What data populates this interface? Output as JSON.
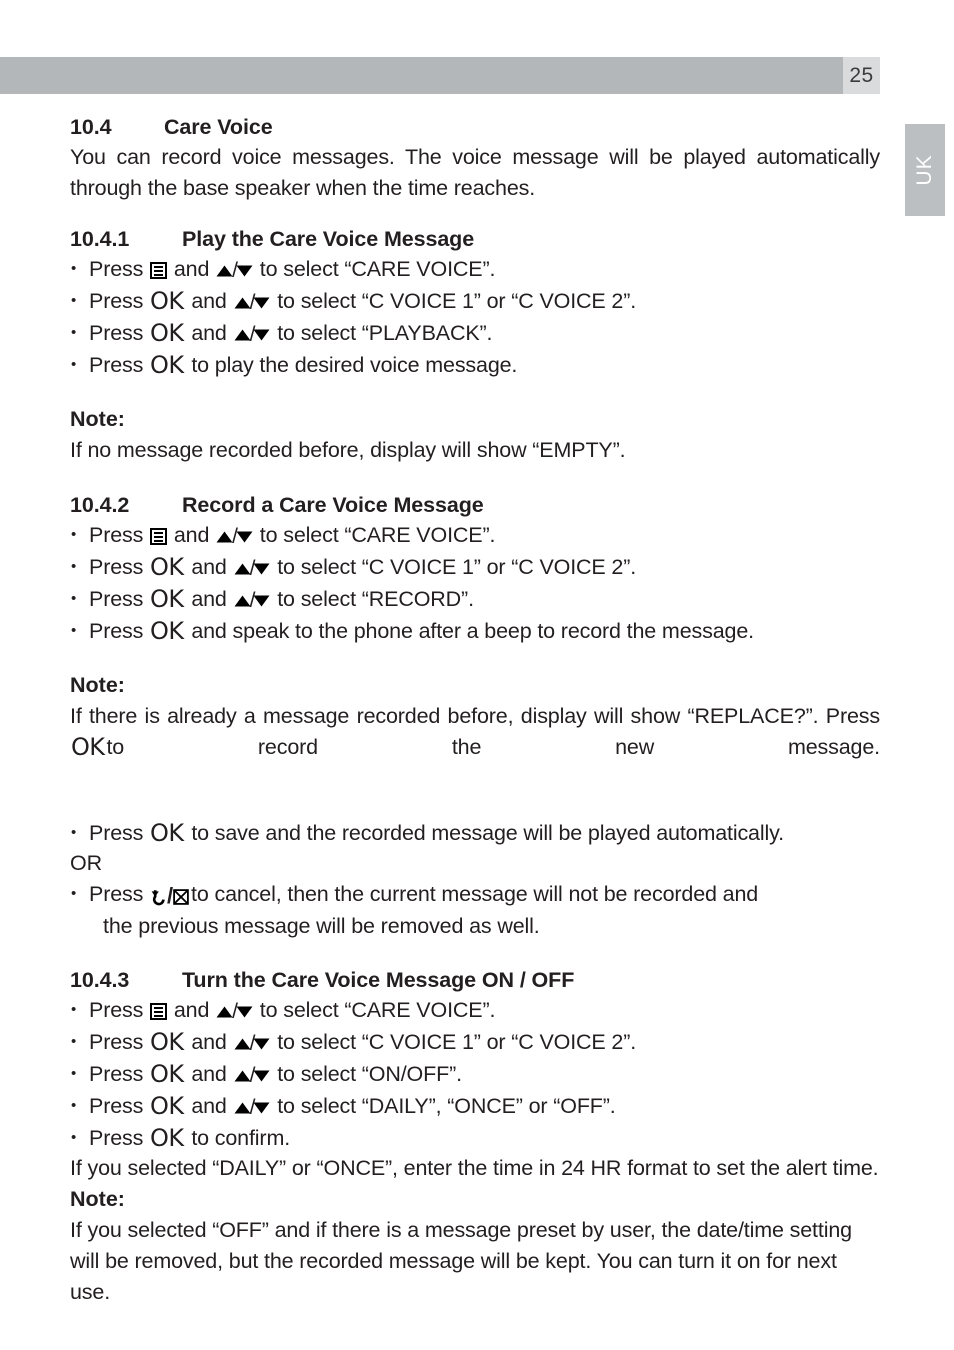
{
  "header": {
    "page_number": "25",
    "language_tab": "UK"
  },
  "sections": [
    {
      "number": "10.4",
      "title": "Care Voice",
      "intro": "You can record voice messages. The voice message will be played automatically through the base speaker when the time reaches."
    },
    {
      "number": "10.4.1",
      "title": "Play the Care Voice Message",
      "steps": [
        {
          "pre": "Press",
          "icon": "menu-icon",
          "mid": "and",
          "icon2": "up-down-arrows-icon",
          "post": "to select “CARE VOICE”."
        },
        {
          "pre": "Press",
          "icon": "ok-key-icon",
          "mid": "and",
          "icon2": "up-down-arrows-icon",
          "post": "to select “C VOICE 1” or  “C VOICE 2”."
        },
        {
          "pre": "Press",
          "icon": "ok-key-icon",
          "mid": "and",
          "icon2": "up-down-arrows-icon",
          "post": "to select  “PLAYBACK”."
        },
        {
          "pre": "Press",
          "icon": "ok-key-icon",
          "post": "to play the desired voice message."
        }
      ],
      "note_label": "Note:",
      "note_text": "If no message recorded before, display will show “EMPTY”."
    },
    {
      "number": "10.4.2",
      "title": "Record a Care Voice Message",
      "steps": [
        {
          "pre": "Press",
          "icon": "menu-icon",
          "mid": "and",
          "icon2": "up-down-arrows-icon",
          "post": "to select “CARE VOICE”."
        },
        {
          "pre": "Press",
          "icon": "ok-key-icon",
          "mid": "and",
          "icon2": "up-down-arrows-icon",
          "post": "to select “C VOICE 1” or “C VOICE 2”."
        },
        {
          "pre": "Press",
          "icon": "ok-key-icon",
          "mid": "and",
          "icon2": "up-down-arrows-icon",
          "post": "to select “RECORD”."
        },
        {
          "pre": "Press",
          "icon": "ok-key-icon",
          "post": "and speak to the phone after a beep to record the message."
        }
      ],
      "note_label": "Note:",
      "note_text_a": "If there is already a message recorded before, display will show “REPLACE?”. Press",
      "note_icon": "ok-key-icon",
      "note_text_b": "to record the new message.",
      "save_step": {
        "pre": "Press",
        "icon": "ok-key-icon",
        "post": "to save and the recorded message will be played automatically."
      },
      "or_label": "OR",
      "cancel_step": {
        "pre": "Press",
        "icon": "back-cancel-icon",
        "post": "to cancel, then the current message will not be recorded and",
        "cont": "the previous message will be removed as well."
      }
    },
    {
      "number": "10.4.3",
      "title": "Turn the Care Voice Message ON / OFF",
      "steps": [
        {
          "pre": "Press",
          "icon": "menu-icon",
          "mid": "and",
          "icon2": "up-down-arrows-icon",
          "post": "to select “CARE VOICE”."
        },
        {
          "pre": "Press",
          "icon": "ok-key-icon",
          "mid": "and",
          "icon2": "up-down-arrows-icon",
          "post": "to select “C VOICE 1” or  “C VOICE 2”."
        },
        {
          "pre": "Press",
          "icon": "ok-key-icon",
          "mid": "and",
          "icon2": "up-down-arrows-icon",
          "post": "to select “ON/OFF”."
        },
        {
          "pre": "Press",
          "icon": "ok-key-icon",
          "mid": "and",
          "icon2": "up-down-arrows-icon",
          "post": "to select  “DAILY”, “ONCE” or “OFF”."
        },
        {
          "pre": "Press",
          "icon": "ok-key-icon",
          "post": "to confirm."
        }
      ],
      "after_text": "If you selected “DAILY” or “ONCE”, enter the time in 24 HR format to set the alert time.",
      "note_label": "Note:",
      "note_text": "If you selected “OFF” and if there is a message preset by user, the date/time setting will be removed, but the recorded message will be kept. You can turn it on for next use."
    }
  ],
  "colors": {
    "header_bar": "#b4b7b9",
    "page_box": "#dadbdc",
    "lang_tab": "#bcbfc1",
    "text": "#231f20"
  }
}
